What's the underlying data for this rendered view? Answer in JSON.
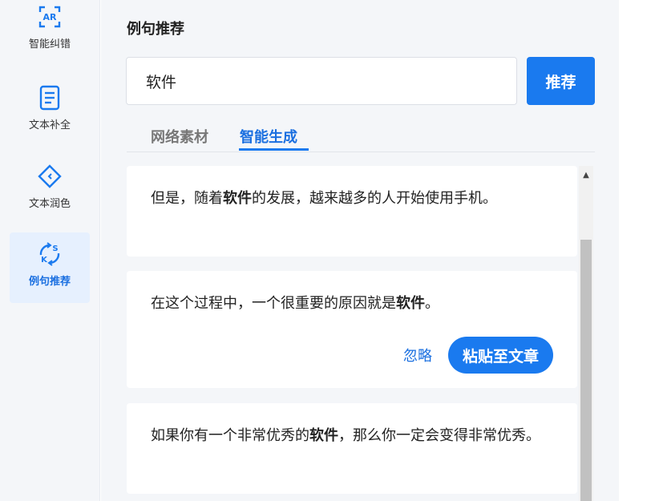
{
  "sidebar": {
    "items": [
      {
        "label": "智能纠错",
        "icon": "spell-check-icon",
        "active": false
      },
      {
        "label": "文本补全",
        "icon": "document-complete-icon",
        "active": false
      },
      {
        "label": "文本润色",
        "icon": "polish-icon",
        "active": false
      },
      {
        "label": "例句推荐",
        "icon": "sentence-swap-icon",
        "active": true
      }
    ]
  },
  "main": {
    "title": "例句推荐",
    "search": {
      "value": "软件",
      "button_label": "推荐"
    },
    "tabs": [
      {
        "label": "网络素材",
        "active": false
      },
      {
        "label": "智能生成",
        "active": true
      }
    ],
    "cards": [
      {
        "before": "但是，随着",
        "keyword": "软件",
        "after": "的发展，越来越多的人开始使用手机。"
      },
      {
        "before": "在这个过程中，一个很重要的原因就是",
        "keyword": "软件",
        "after": "。",
        "ignore_label": "忽略",
        "paste_label": "粘贴至文章"
      },
      {
        "before": "如果你有一个非常优秀的",
        "keyword": "软件",
        "after": "，那么你一定会变得非常优秀。"
      }
    ]
  },
  "colors": {
    "accent": "#1a7aef",
    "sidebar_bg": "#f4f6f9",
    "active_item_bg": "#e6f0fe"
  }
}
